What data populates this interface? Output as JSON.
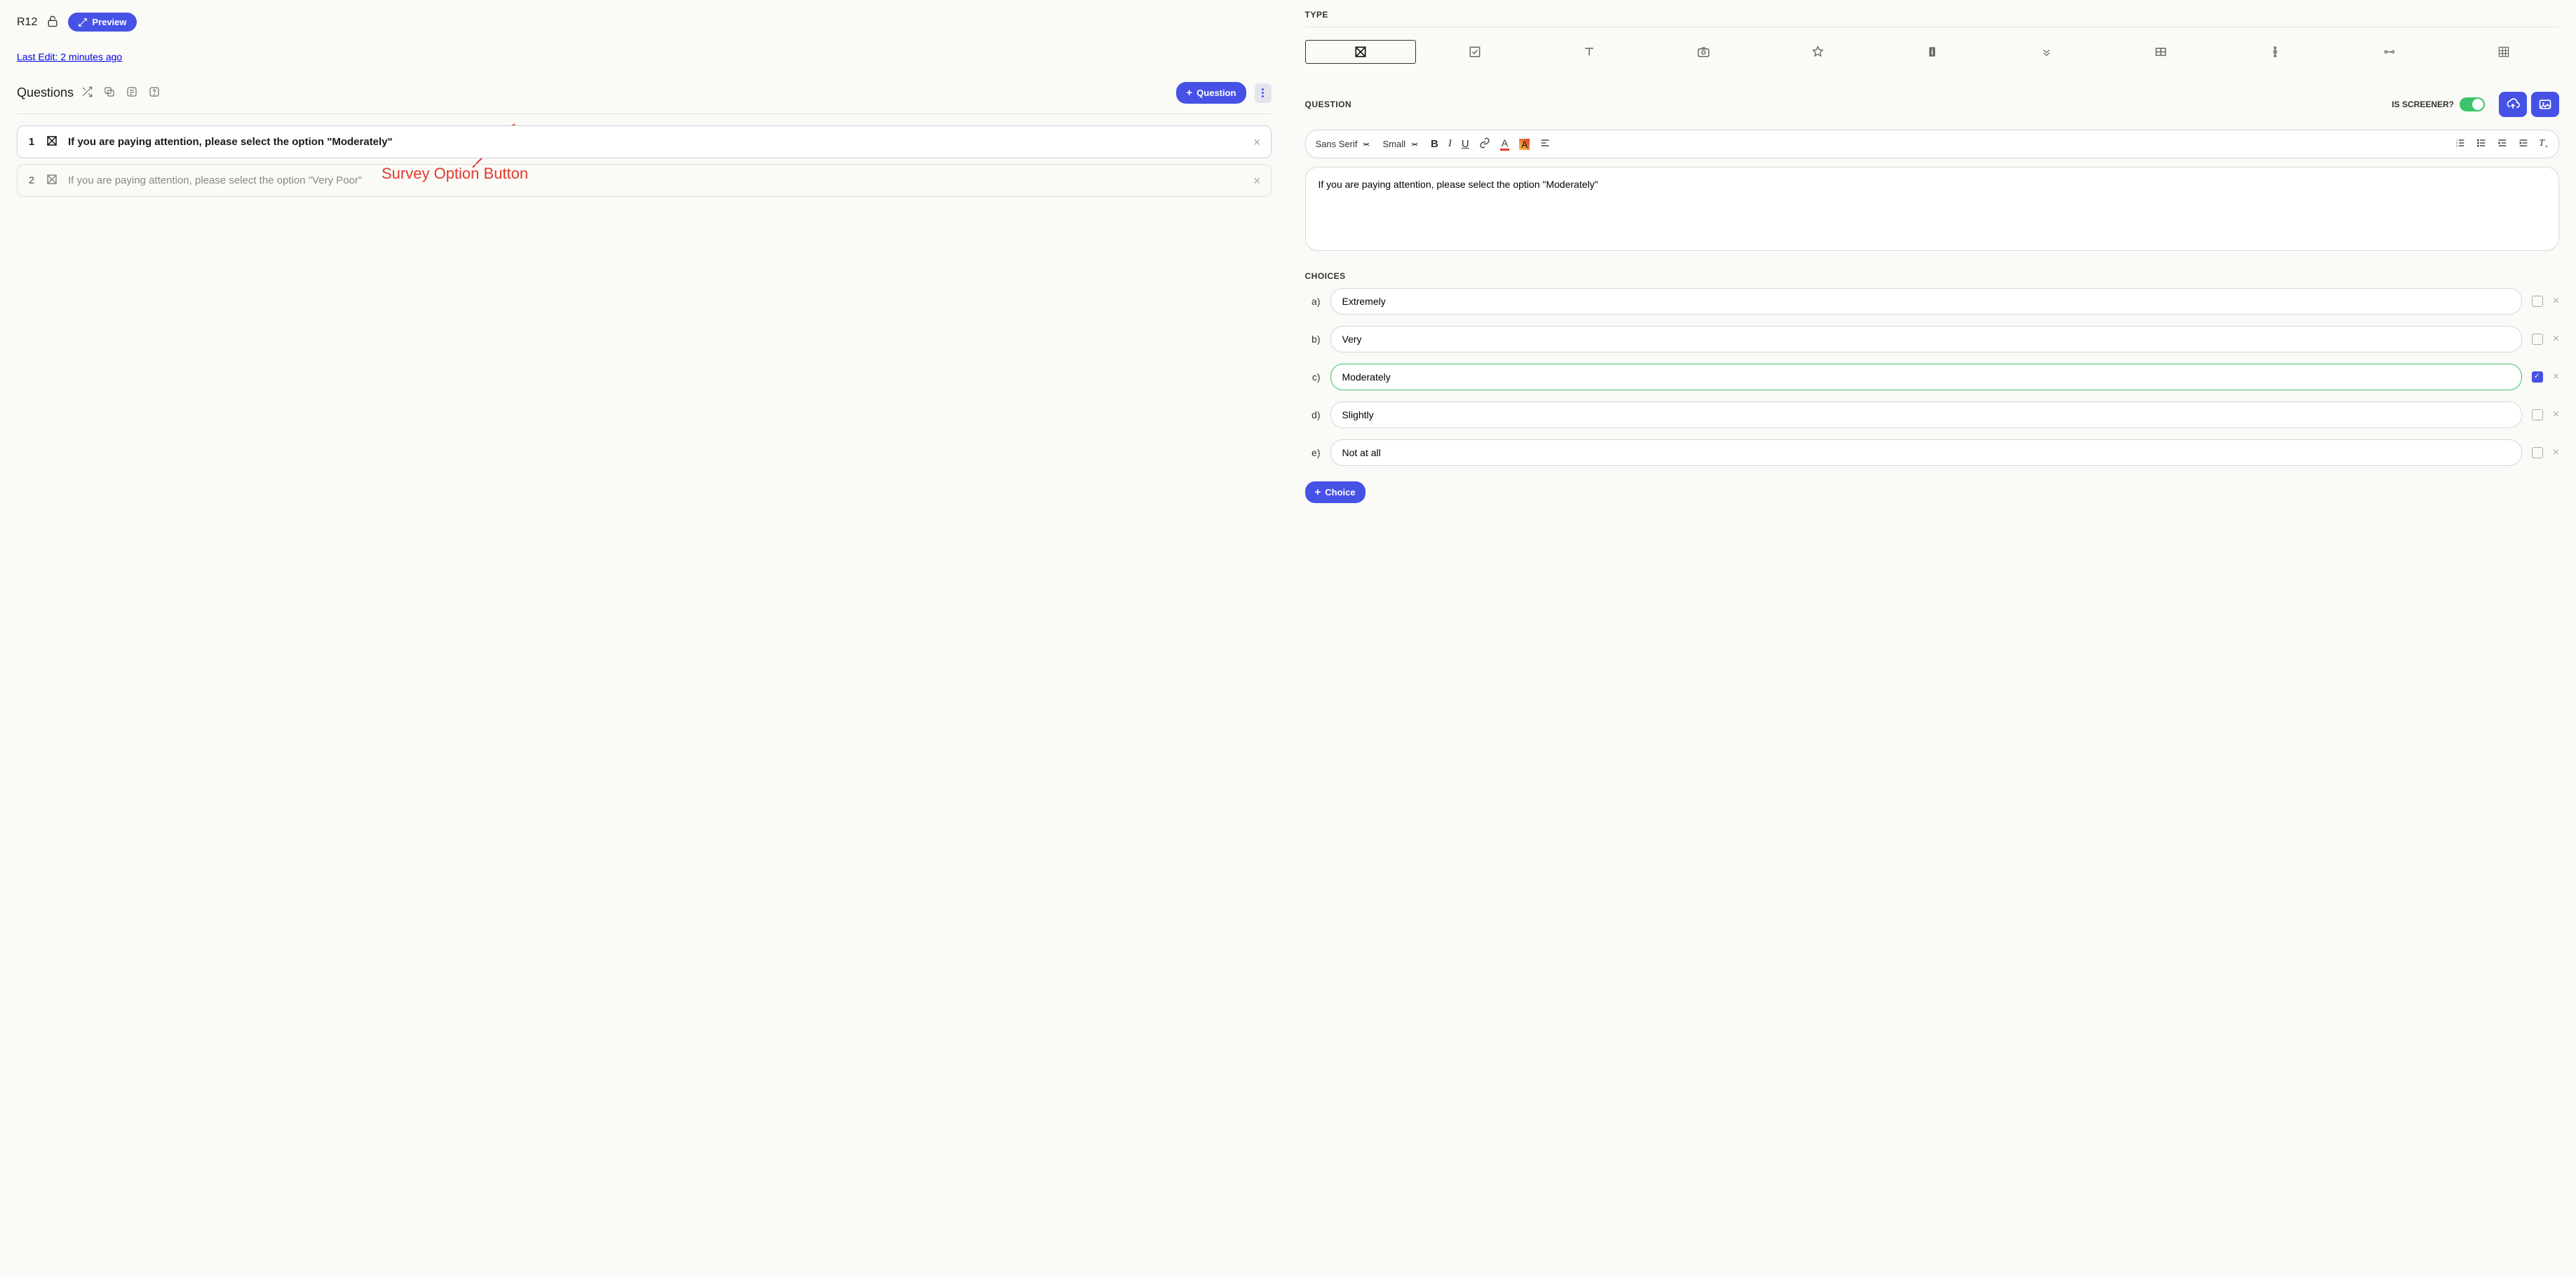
{
  "header": {
    "code": "R12",
    "preview_label": "Preview",
    "last_edit": "Last Edit: 2 minutes ago"
  },
  "questions_panel": {
    "title": "Questions",
    "add_button": "Question",
    "items": [
      {
        "num": "1",
        "text": "If you are paying attention, please select the option \"Moderately\"",
        "active": true
      },
      {
        "num": "2",
        "text": "If you are paying attention, please select the option \"Very Poor\"",
        "active": false
      }
    ]
  },
  "annotation": {
    "label": "Survey Option Button"
  },
  "right": {
    "type_label": "TYPE",
    "question_label": "QUESTION",
    "screener_label": "IS SCREENER?",
    "editor": {
      "font": "Sans Serif",
      "size": "Small"
    },
    "question_text": "If you are paying attention, please select the option \"Moderately\"",
    "choices_label": "CHOICES",
    "choices": [
      {
        "letter": "a)",
        "text": "Extremely",
        "checked": false
      },
      {
        "letter": "b)",
        "text": "Very",
        "checked": false
      },
      {
        "letter": "c)",
        "text": "Moderately",
        "checked": true
      },
      {
        "letter": "d)",
        "text": "Slightly",
        "checked": false
      },
      {
        "letter": "e)",
        "text": "Not at all",
        "checked": false
      }
    ],
    "add_choice_label": "Choice"
  }
}
